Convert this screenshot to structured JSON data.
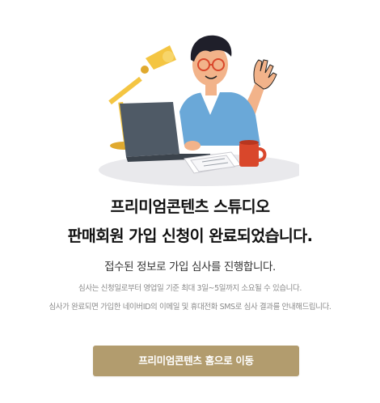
{
  "completion": {
    "title_line1": "프리미엄콘텐츠 스튜디오",
    "title_line2": "판매회원 가입 신청이 완료되었습니다.",
    "subtitle": "접수된 정보로 가입 심사를 진행합니다.",
    "note_line1": "심사는 신청일로부터 영업일 기준 최대 3일~5일까지 소요될 수 있습니다.",
    "note_line2": "심사가 완료되면 가입한 네이버ID의 이메일 및 휴대전화 SMS로 심사 결과를 안내해드립니다.",
    "cta_label": "프리미엄콘텐츠 홈으로 이동"
  },
  "colors": {
    "accent": "#b29c6e",
    "lamp": "#f4c542",
    "shirt": "#6aa8d8",
    "laptop": "#4f5a66",
    "mug": "#d9472b"
  },
  "illustration": {
    "icon": "person-waving-at-laptop-illustration"
  }
}
